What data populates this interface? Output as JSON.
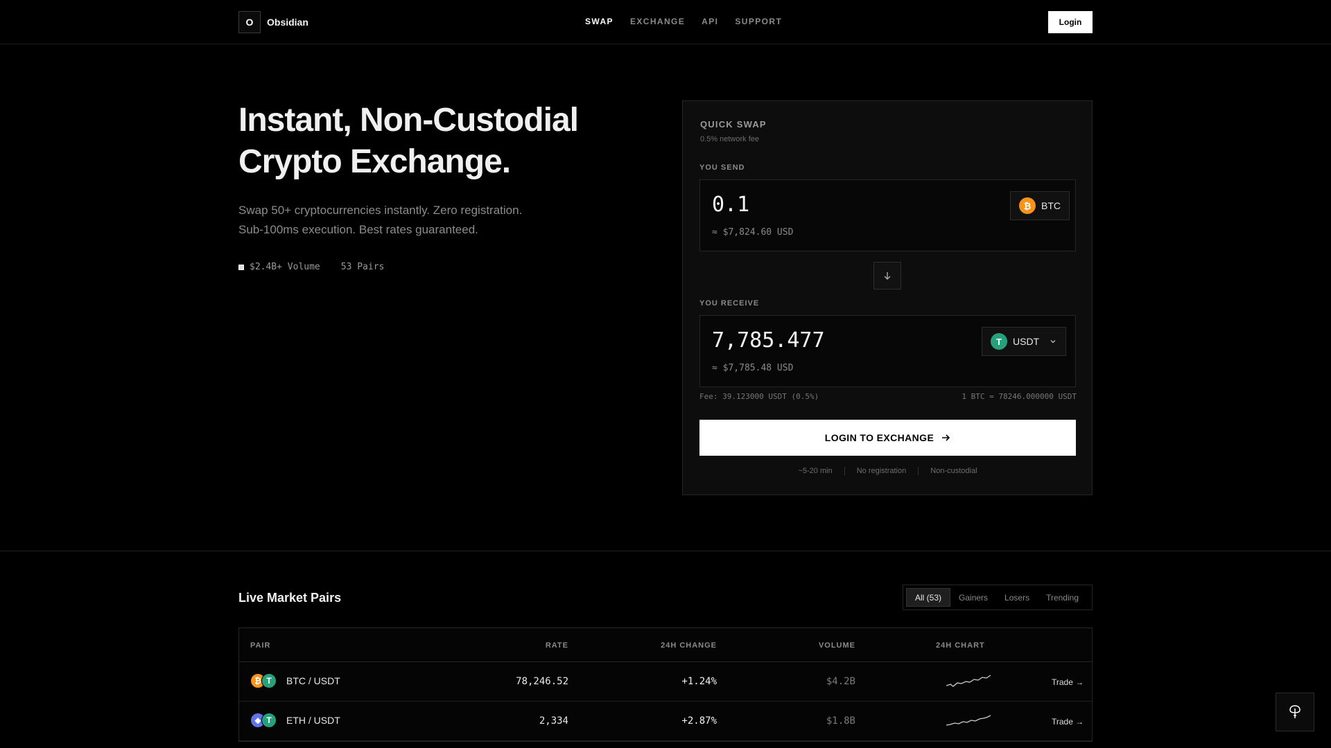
{
  "brand": {
    "logo_letter": "O",
    "name": "Obsidian"
  },
  "nav": {
    "items": [
      "SWAP",
      "EXCHANGE",
      "API",
      "SUPPORT"
    ],
    "active": "SWAP"
  },
  "header": {
    "login_label": "Login"
  },
  "hero": {
    "title_line1": "Instant, Non-Custodial",
    "title_line2": "Crypto Exchange.",
    "sub_line1": "Swap 50+ cryptocurrencies instantly. Zero registration.",
    "sub_line2": "Sub-100ms execution. Best rates guaranteed.",
    "stat_volume": "$2.4B+ Volume",
    "stat_pairs": "53 Pairs"
  },
  "swap": {
    "title": "QUICK SWAP",
    "fee_note": "0.5% network fee",
    "send_label": "YOU SEND",
    "send_amount": "0.1",
    "send_usd": "≈ $7,824.60 USD",
    "send_token": "BTC",
    "receive_label": "YOU RECEIVE",
    "receive_amount": "7,785.477",
    "receive_usd": "≈ $7,785.48 USD",
    "receive_token": "USDT",
    "fee_text": "Fee: 39.123000 USDT (0.5%)",
    "rate_text": "1 BTC = 78246.000000 USDT",
    "cta_label": "LOGIN TO EXCHANGE",
    "badges": [
      "~5-20 min",
      "No registration",
      "Non-custodial"
    ]
  },
  "market": {
    "title": "Live Market Pairs",
    "filters": [
      "All (53)",
      "Gainers",
      "Losers",
      "Trending"
    ],
    "active_filter": "All (53)",
    "columns": [
      "PAIR",
      "RATE",
      "24H CHANGE",
      "VOLUME",
      "24H CHART"
    ],
    "rows": [
      {
        "pair": "BTC / USDT",
        "base_icon": "bitcoin-icon",
        "quote_icon": "tether-icon",
        "rate": "78,246.52",
        "change": "+1.24%",
        "volume": "$4.2B",
        "action": "Trade →"
      },
      {
        "pair": "ETH / USDT",
        "base_icon": "ethereum-icon",
        "quote_icon": "tether-icon",
        "rate": "2,334",
        "change": "+2.87%",
        "volume": "$1.8B",
        "action": "Trade →"
      }
    ]
  },
  "colors": {
    "background": "#000000",
    "btc": "#f7931a",
    "usdt": "#26a17b",
    "eth": "#6273e8",
    "accent": "#ffffff"
  },
  "icons": {
    "swap_direction": "arrow-down-icon",
    "cta_arrow": "arrow-right-icon",
    "token_dropdown": "chevron-down-icon",
    "floating": "map-pin-icon"
  }
}
